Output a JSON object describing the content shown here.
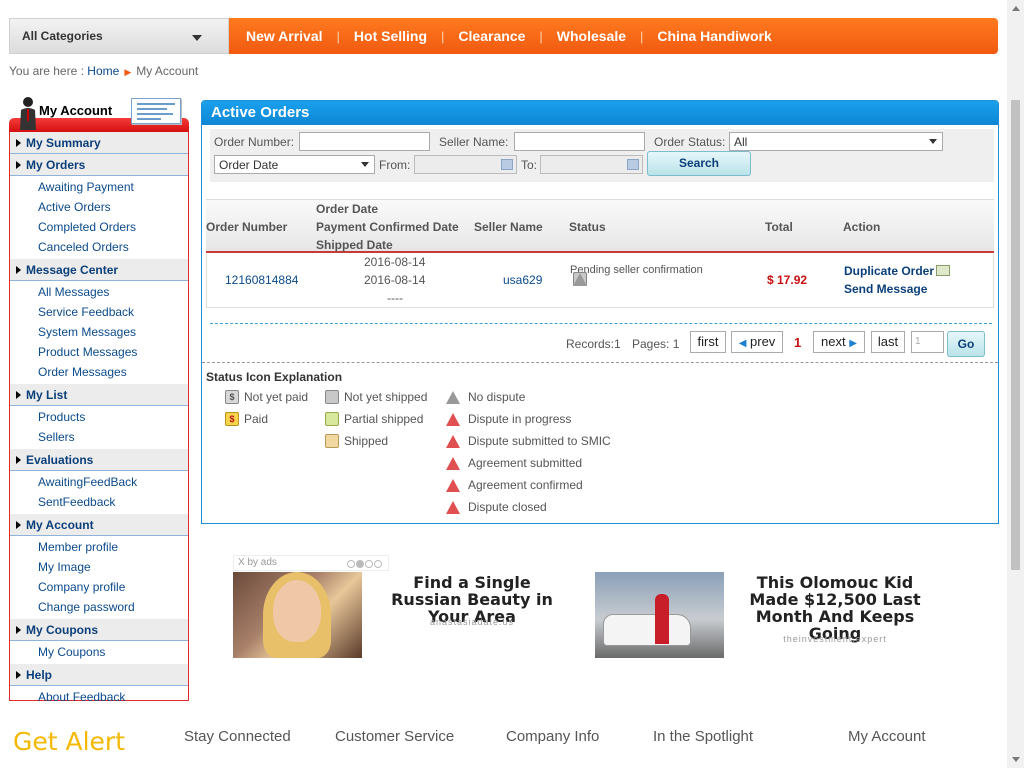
{
  "topnav": {
    "category_label": "All Categories",
    "items": [
      "New Arrival",
      "Hot Selling",
      "Clearance",
      "Wholesale",
      "China Handiwork"
    ]
  },
  "breadcrumb": {
    "prefix": "You are here :",
    "home": "Home",
    "current": "My Account"
  },
  "sidebar": {
    "title": "My Account",
    "sections": [
      {
        "label": "My Summary",
        "items": []
      },
      {
        "label": "My Orders",
        "items": [
          "Awaiting Payment",
          "Active Orders",
          "Completed Orders",
          "Canceled Orders"
        ]
      },
      {
        "label": "Message Center",
        "items": [
          "All Messages",
          "Service Feedback",
          "System Messages",
          "Product Messages",
          "Order Messages"
        ]
      },
      {
        "label": "My List",
        "items": [
          "Products",
          "Sellers"
        ]
      },
      {
        "label": "Evaluations",
        "items": [
          "AwaitingFeedBack",
          "SentFeedback"
        ]
      },
      {
        "label": "My Account",
        "items": [
          "Member profile",
          "My Image",
          "Company profile",
          "Change password"
        ]
      },
      {
        "label": "My Coupons",
        "items": [
          "My Coupons"
        ]
      },
      {
        "label": "Help",
        "items": [
          "About Feedback"
        ]
      }
    ]
  },
  "panel": {
    "title": "Active Orders",
    "filter": {
      "order_number_label": "Order Number:",
      "order_number_value": "",
      "seller_name_label": "Seller Name:",
      "seller_name_value": "",
      "order_status_label": "Order Status:",
      "order_status_value": "All",
      "date_type_value": "Order Date",
      "from_label": "From:",
      "to_label": "To:",
      "search_label": "Search"
    },
    "table": {
      "headers": {
        "order_number": "Order Number",
        "date_1": "Order Date",
        "date_2": "Payment Confirmed Date",
        "date_3": "Shipped Date",
        "seller": "Seller Name",
        "status": "Status",
        "total": "Total",
        "action": "Action"
      },
      "rows": [
        {
          "order_number": "12160814884",
          "order_date": "2016-08-14",
          "payment_date": "2016-08-14",
          "shipped_date": "----",
          "seller": "usa629",
          "status": "Pending seller confirmation",
          "total": "$ 17.92",
          "action_1": "Duplicate Order",
          "action_2": "Send Message"
        }
      ]
    },
    "pager": {
      "records": "Records:1",
      "pages": "Pages: 1",
      "first": "first",
      "prev": "prev",
      "current": "1",
      "next": "next",
      "last": "last",
      "goto_placeholder": "1",
      "go": "Go"
    },
    "legend": {
      "title": "Status Icon Explanation",
      "payment": [
        "Not yet paid",
        "Paid"
      ],
      "shipping": [
        "Not yet shipped",
        "Partial shipped",
        "Shipped"
      ],
      "dispute": [
        "No dispute",
        "Dispute in progress",
        "Dispute submitted to SMIC",
        "Agreement submitted",
        "Agreement confirmed",
        "Dispute closed"
      ]
    }
  },
  "ads": {
    "label": "by ads",
    "items": [
      {
        "title": "Find a Single Russian Beauty in Your Area",
        "source": "anastasiadate.us"
      },
      {
        "title": "This Olomouc Kid Made $12,500 Last Month And Keeps Going",
        "source": "theinvestment.expert"
      }
    ]
  },
  "footer": {
    "get_alert": "Get Alert",
    "links": [
      "Stay Connected",
      "Customer Service",
      "Company Info",
      "In the Spotlight",
      "My Account"
    ]
  }
}
